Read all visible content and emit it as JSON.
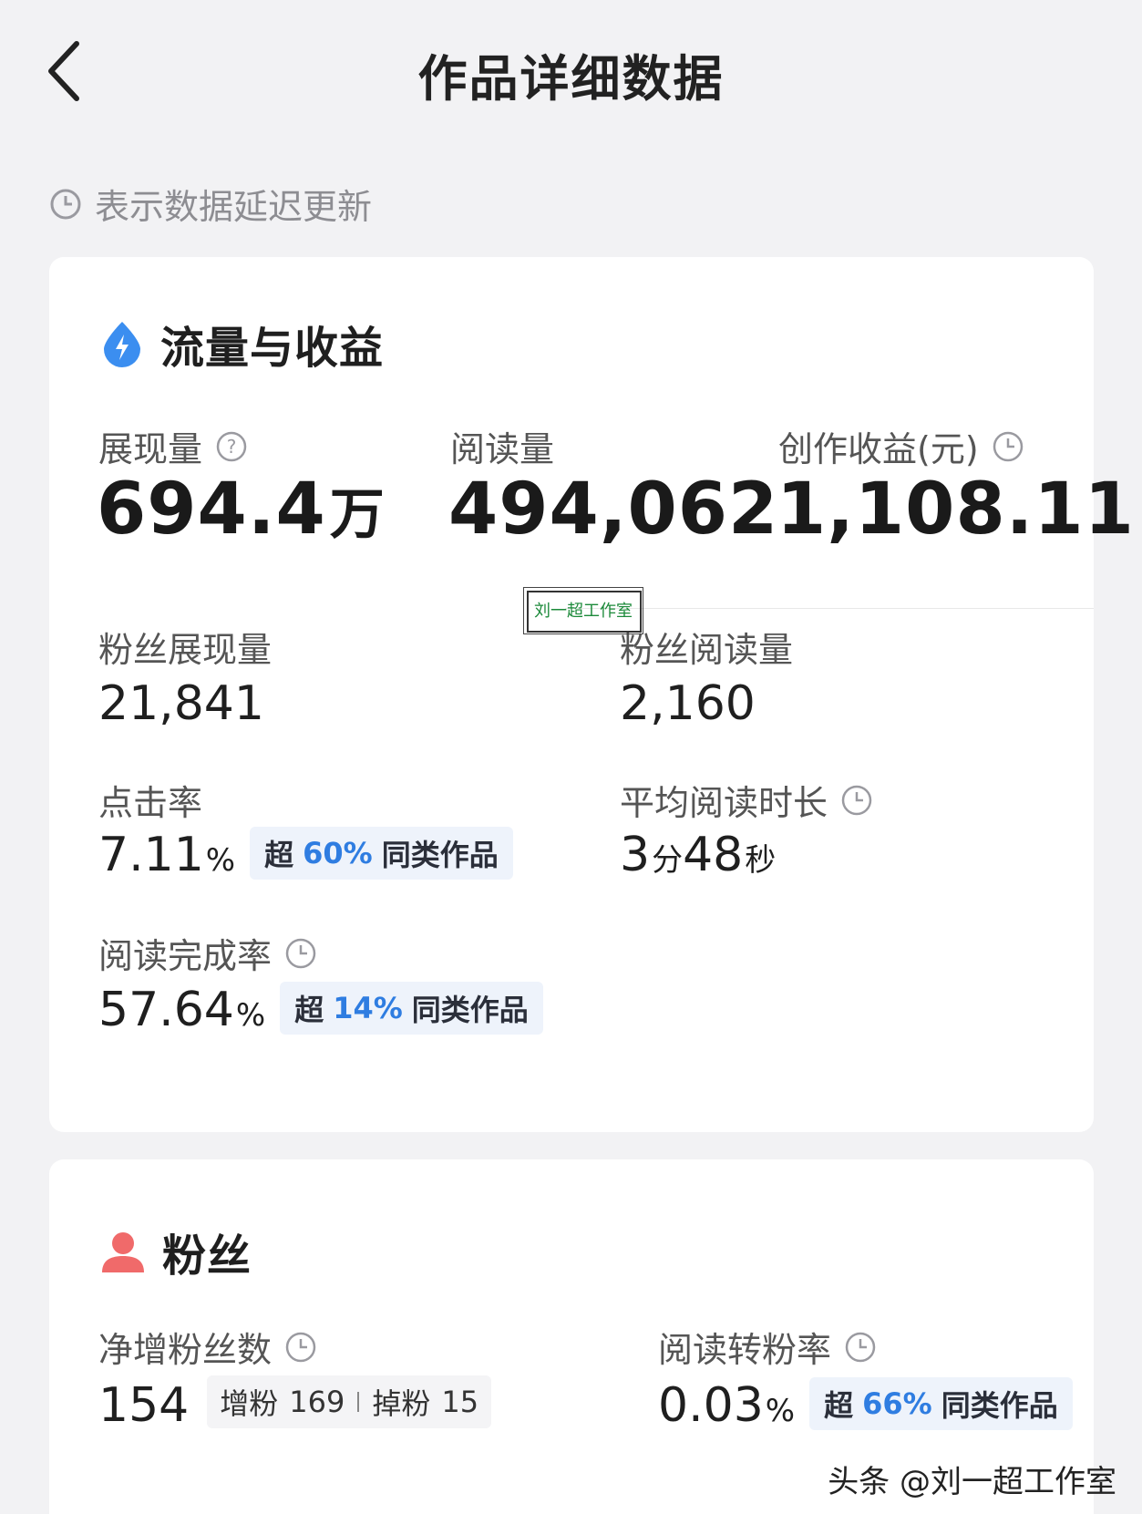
{
  "header": {
    "title": "作品详细数据",
    "back_icon": "chevron-left-icon"
  },
  "notice": {
    "text": "表示数据延迟更新",
    "icon": "clock-icon"
  },
  "traffic": {
    "section_title": "流量与收益",
    "section_icon": "lightning-drop-icon",
    "impressions": {
      "label": "展现量",
      "value": "694.4",
      "unit": "万"
    },
    "reads": {
      "label": "阅读量",
      "value": "494,062"
    },
    "income": {
      "label": "创作收益(元)",
      "value": "1,108.11"
    },
    "fan_impressions": {
      "label": "粉丝展现量",
      "value": "21,841"
    },
    "fan_reads": {
      "label": "粉丝阅读量",
      "value": "2,160"
    },
    "ctr": {
      "label": "点击率",
      "value": "7.11",
      "unit": "%",
      "badge_prefix": "超",
      "badge_pct": "60%",
      "badge_suffix": "同类作品"
    },
    "avg_read_time": {
      "label": "平均阅读时长",
      "min": "3",
      "min_unit": "分",
      "sec": "48",
      "sec_unit": "秒"
    },
    "completion": {
      "label": "阅读完成率",
      "value": "57.64",
      "unit": "%",
      "badge_prefix": "超",
      "badge_pct": "14%",
      "badge_suffix": "同类作品"
    }
  },
  "stamp": {
    "text": "刘一超工作室"
  },
  "fans": {
    "section_title": "粉丝",
    "section_icon": "user-icon",
    "net_gain": {
      "label": "净增粉丝数",
      "value": "154",
      "gain_label": "增粉",
      "gain": "169",
      "loss_label": "掉粉",
      "loss": "15"
    },
    "conversion": {
      "label": "阅读转粉率",
      "value": "0.03",
      "unit": "%",
      "badge_prefix": "超",
      "badge_pct": "66%",
      "badge_suffix": "同类作品"
    }
  },
  "watermark": "头条 @刘一超工作室",
  "colors": {
    "accent_blue": "#2f7de1",
    "fan_red": "#f06a6a",
    "stamp_green": "#1c8a3a"
  }
}
